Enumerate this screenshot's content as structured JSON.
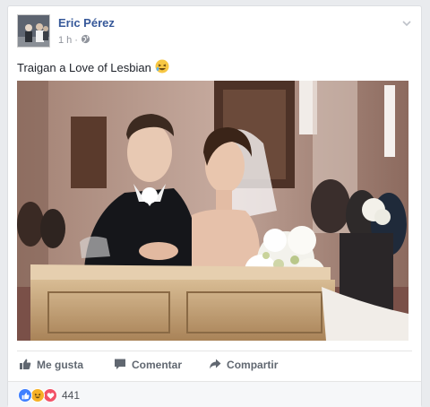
{
  "post": {
    "author": "Eric Pérez",
    "time": "1 h",
    "separator": "·",
    "text": "Traigan a Love of Lesbian",
    "audience_icon": "globe-icon",
    "emoji": "laughing-emoji"
  },
  "actions": {
    "like_label": "Me gusta",
    "comment_label": "Comentar",
    "share_label": "Compartir"
  },
  "reactions": {
    "types": [
      "like",
      "haha",
      "love"
    ],
    "count": "441"
  },
  "colors": {
    "name": "#365899",
    "like": "#4080ff",
    "haha": "#f7b125",
    "love": "#f25268"
  }
}
